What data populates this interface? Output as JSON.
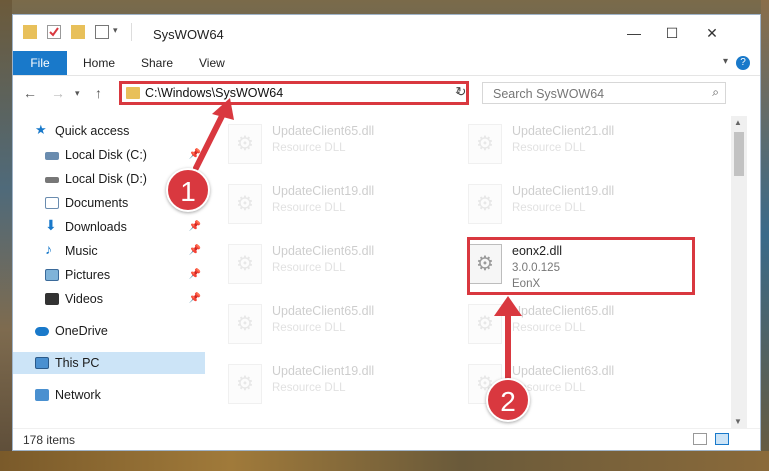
{
  "window": {
    "title": "SysWOW64"
  },
  "ribbon": {
    "tabs": [
      "File",
      "Home",
      "Share",
      "View"
    ],
    "help": "?"
  },
  "address": {
    "path": "C:\\Windows\\SysWOW64"
  },
  "search": {
    "placeholder": "Search SysWOW64"
  },
  "nav": {
    "items": [
      {
        "label": "Quick access",
        "pinned": false
      },
      {
        "label": "Local Disk (C:)",
        "pinned": true
      },
      {
        "label": "Local Disk (D:)",
        "pinned": true
      },
      {
        "label": "Documents",
        "pinned": true
      },
      {
        "label": "Downloads",
        "pinned": true
      },
      {
        "label": "Music",
        "pinned": true
      },
      {
        "label": "Pictures",
        "pinned": true
      },
      {
        "label": "Videos",
        "pinned": true
      },
      {
        "label": "OneDrive",
        "pinned": false
      },
      {
        "label": "This PC",
        "pinned": false,
        "selected": true
      },
      {
        "label": "Network",
        "pinned": false
      }
    ]
  },
  "files": [
    {
      "name": "UpdateClient65.dll",
      "desc": "Resource DLL"
    },
    {
      "name": "UpdateClient21.dll",
      "desc": "Resource DLL"
    },
    {
      "name": "UpdateClient19.dll",
      "desc": "Resource DLL"
    },
    {
      "name": "UpdateClient19.dll",
      "desc": "Resource DLL"
    },
    {
      "name": "UpdateClient65.dll",
      "desc": "Resource DLL"
    },
    {
      "name": "eonx2.dll",
      "version": "3.0.0.125",
      "company": "EonX"
    },
    {
      "name": "UpdateClient65.dll",
      "desc": "Resource DLL"
    },
    {
      "name": "UpdateClient65.dll",
      "desc": "Resource DLL"
    },
    {
      "name": "UpdateClient19.dll",
      "desc": "Resource DLL"
    },
    {
      "name": "UpdateClient63.dll",
      "desc": "Resource DLL"
    }
  ],
  "status": {
    "item_count": "178 items"
  },
  "callouts": [
    "1",
    "2"
  ],
  "colors": {
    "accent": "#1979ca",
    "highlight": "#d9383f"
  }
}
